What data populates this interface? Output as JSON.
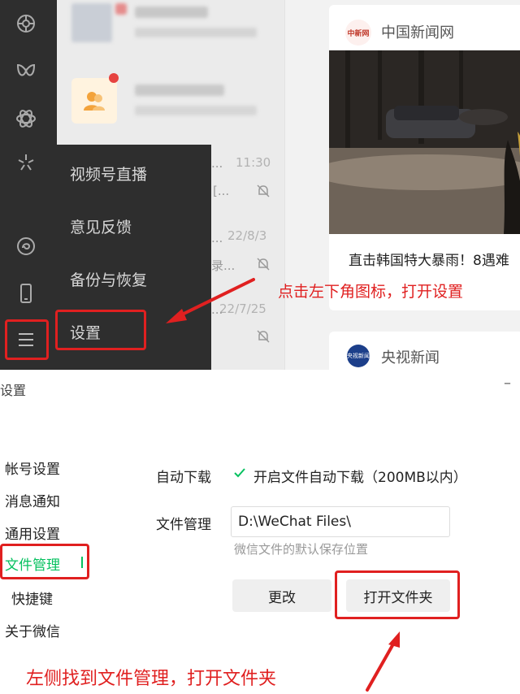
{
  "wechat": {
    "chat_times": [
      "11:30",
      "22/8/3",
      "22/7/25"
    ],
    "chat_fragments": [
      "...",
      "[...",
      "...",
      "录...",
      "..."
    ],
    "menu_items": [
      "视频号直播",
      "意见反馈",
      "备份与恢复",
      "设置"
    ],
    "feed_card": {
      "source": "中国新闻网",
      "logo_text": "中新网",
      "title": "直击韩国特大暴雨！8遇难"
    },
    "feed_card2": {
      "source": "央视新闻",
      "logo_text": "央视新闻"
    },
    "annotation": "点击左下角图标，打开设置"
  },
  "settings": {
    "window_title": "设置",
    "minimize": "–",
    "nav": [
      "帐号设置",
      "消息通知",
      "通用设置",
      "文件管理",
      "快捷键",
      "关于微信"
    ],
    "auto_download_label": "自动下载",
    "auto_download_option": "开启文件自动下载（200MB以内）",
    "file_mgmt_label": "文件管理",
    "path_value": "D:\\WeChat Files\\",
    "path_hint": "微信文件的默认保存位置",
    "change_button": "更改",
    "open_folder_button": "打开文件夹",
    "annotation": "左侧找到文件管理，打开文件夹"
  },
  "colors": {
    "annotation_red": "#e02020",
    "wechat_green": "#07c160",
    "sidebar_dark": "#2e2e2e"
  }
}
